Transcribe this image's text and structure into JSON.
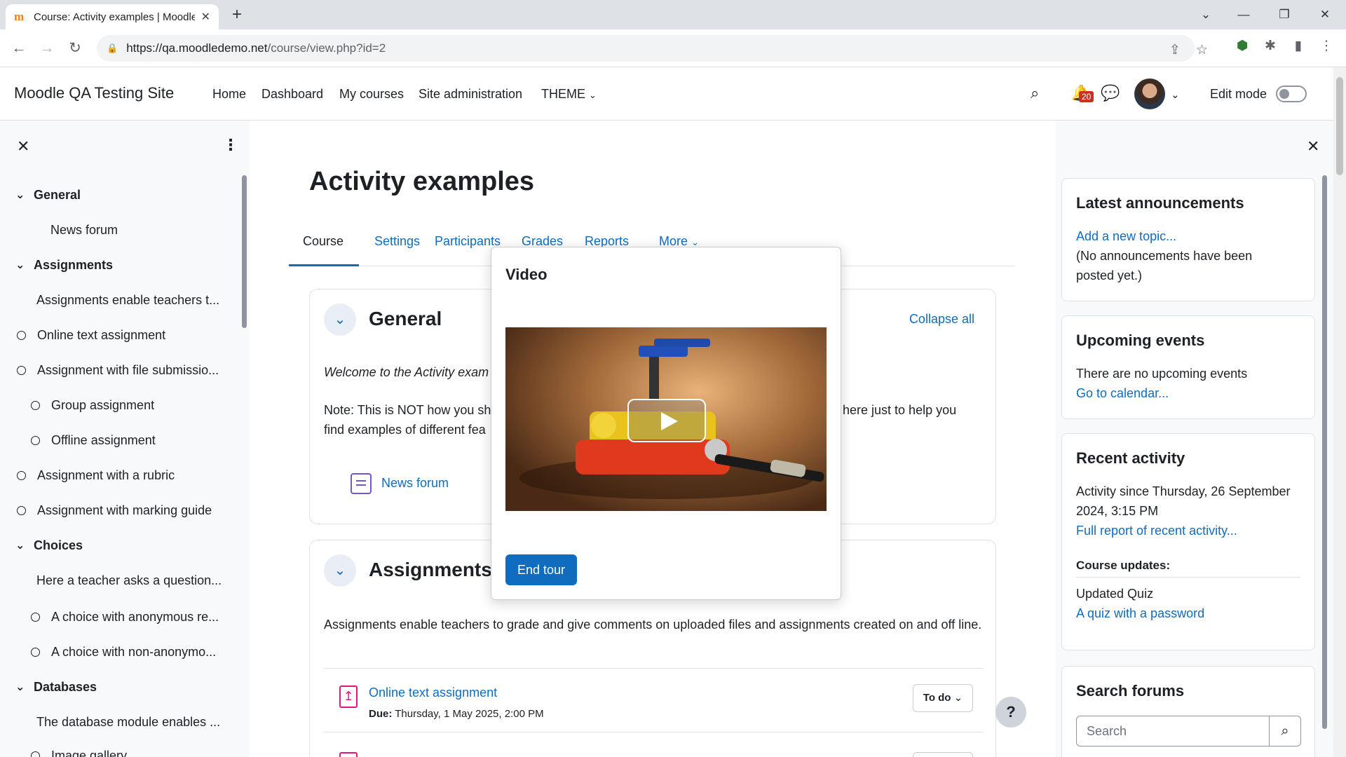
{
  "browser": {
    "tab_title": "Course: Activity examples | Moodle QA Testing Site",
    "tab_favicon": "m",
    "url_domain": "https://qa.moodledemo.net",
    "url_path": "/course/view.php?id=2"
  },
  "navbar": {
    "site_name": "Moodle QA Testing Site",
    "items": [
      "Home",
      "Dashboard",
      "My courses",
      "Site administration",
      "THEME"
    ],
    "notifications_count": "20",
    "edit_mode_label": "Edit mode"
  },
  "course_index": {
    "entries": [
      {
        "label": "General",
        "type": "section"
      },
      {
        "label": "News forum",
        "type": "activity"
      },
      {
        "label": "Assignments",
        "type": "section"
      },
      {
        "label": "Assignments enable teachers t...",
        "type": "label"
      },
      {
        "label": "Online text assignment",
        "type": "activity"
      },
      {
        "label": "Assignment with file submissio...",
        "type": "activity"
      },
      {
        "label": "Group assignment",
        "type": "activity"
      },
      {
        "label": "Offline assignment",
        "type": "activity"
      },
      {
        "label": "Assignment with a rubric",
        "type": "activity"
      },
      {
        "label": "Assignment with marking guide",
        "type": "activity"
      },
      {
        "label": "Choices",
        "type": "section"
      },
      {
        "label": "Here a teacher asks a question...",
        "type": "label"
      },
      {
        "label": "A choice with anonymous re...",
        "type": "activity"
      },
      {
        "label": "A choice with non-anonymo...",
        "type": "activity"
      },
      {
        "label": "Databases",
        "type": "section"
      },
      {
        "label": "The database module enables ...",
        "type": "label"
      },
      {
        "label": "Image gallery",
        "type": "activity"
      }
    ]
  },
  "main": {
    "title": "Activity examples",
    "tabs": [
      "Course",
      "Settings",
      "Participants",
      "Grades",
      "Reports",
      "More"
    ],
    "active_tab": "Course",
    "general": {
      "title": "General",
      "collapse_all": "Collapse all",
      "welcome_start": "Welcome to the Activity exam",
      "note_start": "Note: This is NOT how you sh",
      "note_end": "here just to help you",
      "note_line2": "find examples of different fea",
      "forum_link": "News forum"
    },
    "assignments": {
      "title": "Assignments",
      "description": "Assignments enable teachers to grade and give comments on uploaded files and assignments created on and off line.",
      "item_title": "Online text assignment",
      "due_label": "Due:",
      "due_value": "Thursday, 1 May 2025, 2:00 PM",
      "todo_label": "To do"
    }
  },
  "tour": {
    "title": "Video",
    "end_button": "End tour"
  },
  "blocks": {
    "announcements": {
      "title": "Latest announcements",
      "link": "Add a new topic...",
      "text": "(No announcements have been posted yet.)"
    },
    "upcoming": {
      "title": "Upcoming events",
      "text": "There are no upcoming events",
      "link": "Go to calendar..."
    },
    "recent": {
      "title": "Recent activity",
      "since": "Activity since Thursday, 26 September 2024, 3:15 PM",
      "link": "Full report of recent activity...",
      "updates_title": "Course updates:",
      "update_text": "Updated Quiz",
      "update_link": "A quiz with a password"
    },
    "search_forums": {
      "title": "Search forums",
      "placeholder": "Search"
    }
  },
  "help_button": "?"
}
